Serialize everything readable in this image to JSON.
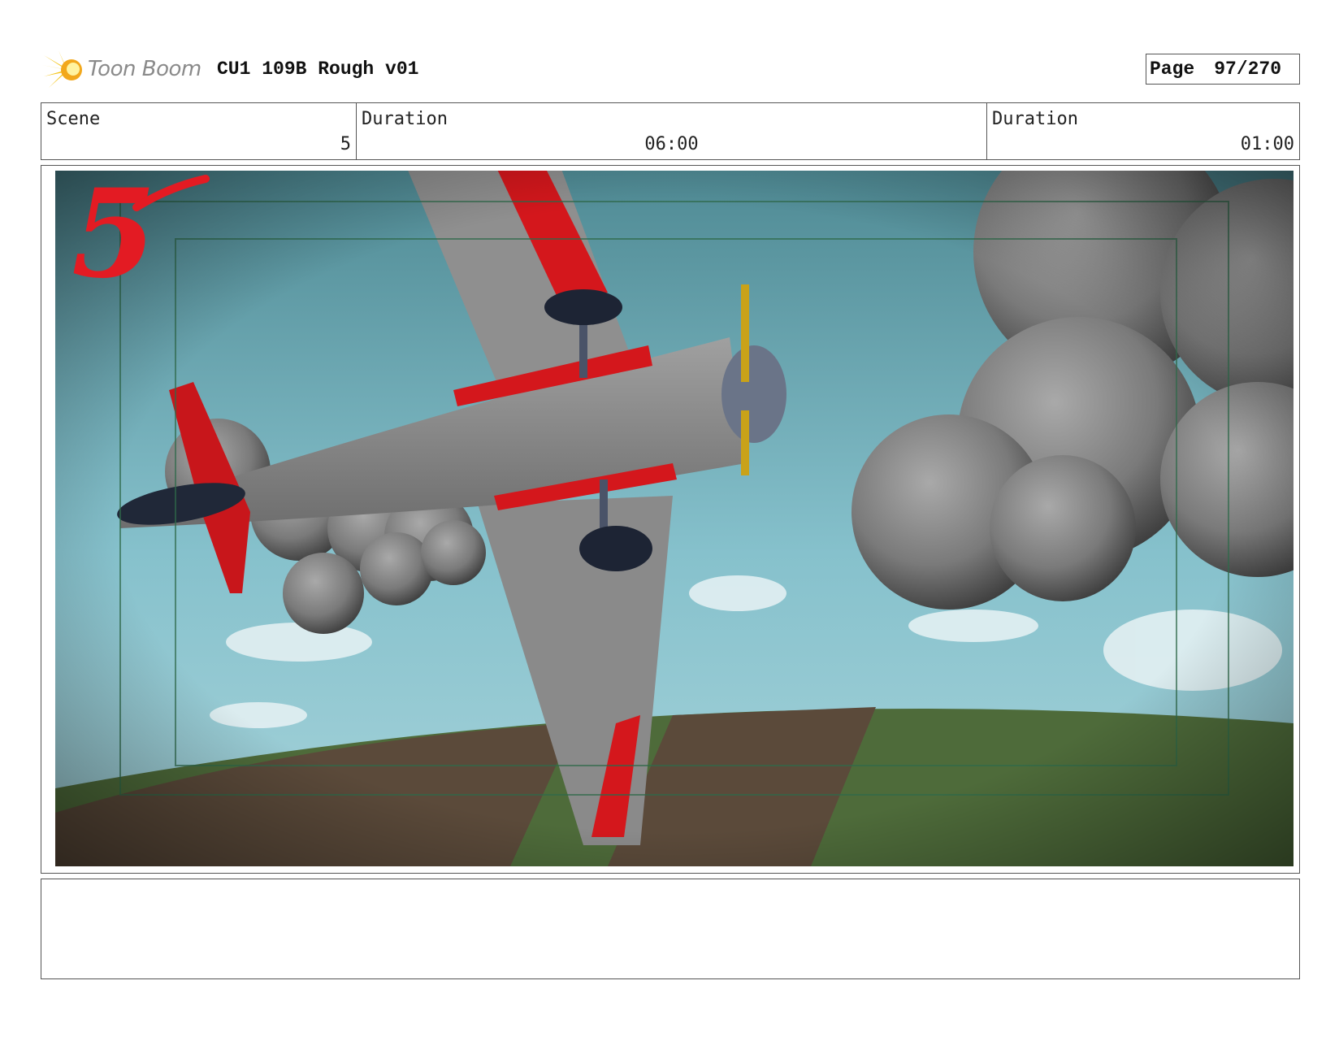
{
  "header": {
    "logo_text": "Toon Boom",
    "title": "CU1 109B Rough v01",
    "page_label": "Page",
    "page_number": "97/270"
  },
  "info": {
    "scene_label": "Scene",
    "scene_value": "5",
    "duration_label": "Duration",
    "duration_value": "06:00",
    "duration2_label": "Duration",
    "duration2_value": "01:00"
  },
  "panel": {
    "drawn_number": "5"
  },
  "notes": {
    "text": ""
  }
}
